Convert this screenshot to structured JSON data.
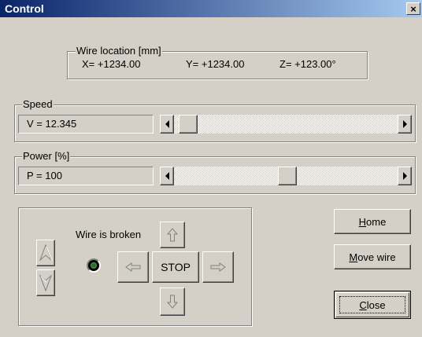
{
  "window": {
    "title": "Control",
    "close_glyph": "×"
  },
  "wire_location": {
    "legend": "Wire location [mm]",
    "x": "X= +1234.00",
    "y": "Y= +1234.00",
    "z": "Z= +123.00°"
  },
  "speed": {
    "legend": "Speed",
    "value_text": "V =  12.345",
    "slider_position": 0.02
  },
  "power": {
    "legend": "Power [%]",
    "value_text": "P =   100",
    "slider_position": 0.5
  },
  "jog": {
    "status_label": "Wire is broken",
    "led_state": "on",
    "stop_label": "STOP"
  },
  "buttons": {
    "home_prefix": "",
    "home_mnemonic": "H",
    "home_rest": "ome",
    "move_prefix": "",
    "move_mnemonic": "M",
    "move_rest": "ove wire",
    "close_prefix": "",
    "close_mnemonic": "C",
    "close_rest": "lose"
  },
  "icons": {
    "close": "close-icon",
    "left": "arrow-left-icon",
    "right": "arrow-right-icon",
    "up": "arrow-up-icon",
    "down": "arrow-down-icon",
    "tilt_up": "tilt-up-icon",
    "tilt_down": "tilt-down-icon"
  }
}
